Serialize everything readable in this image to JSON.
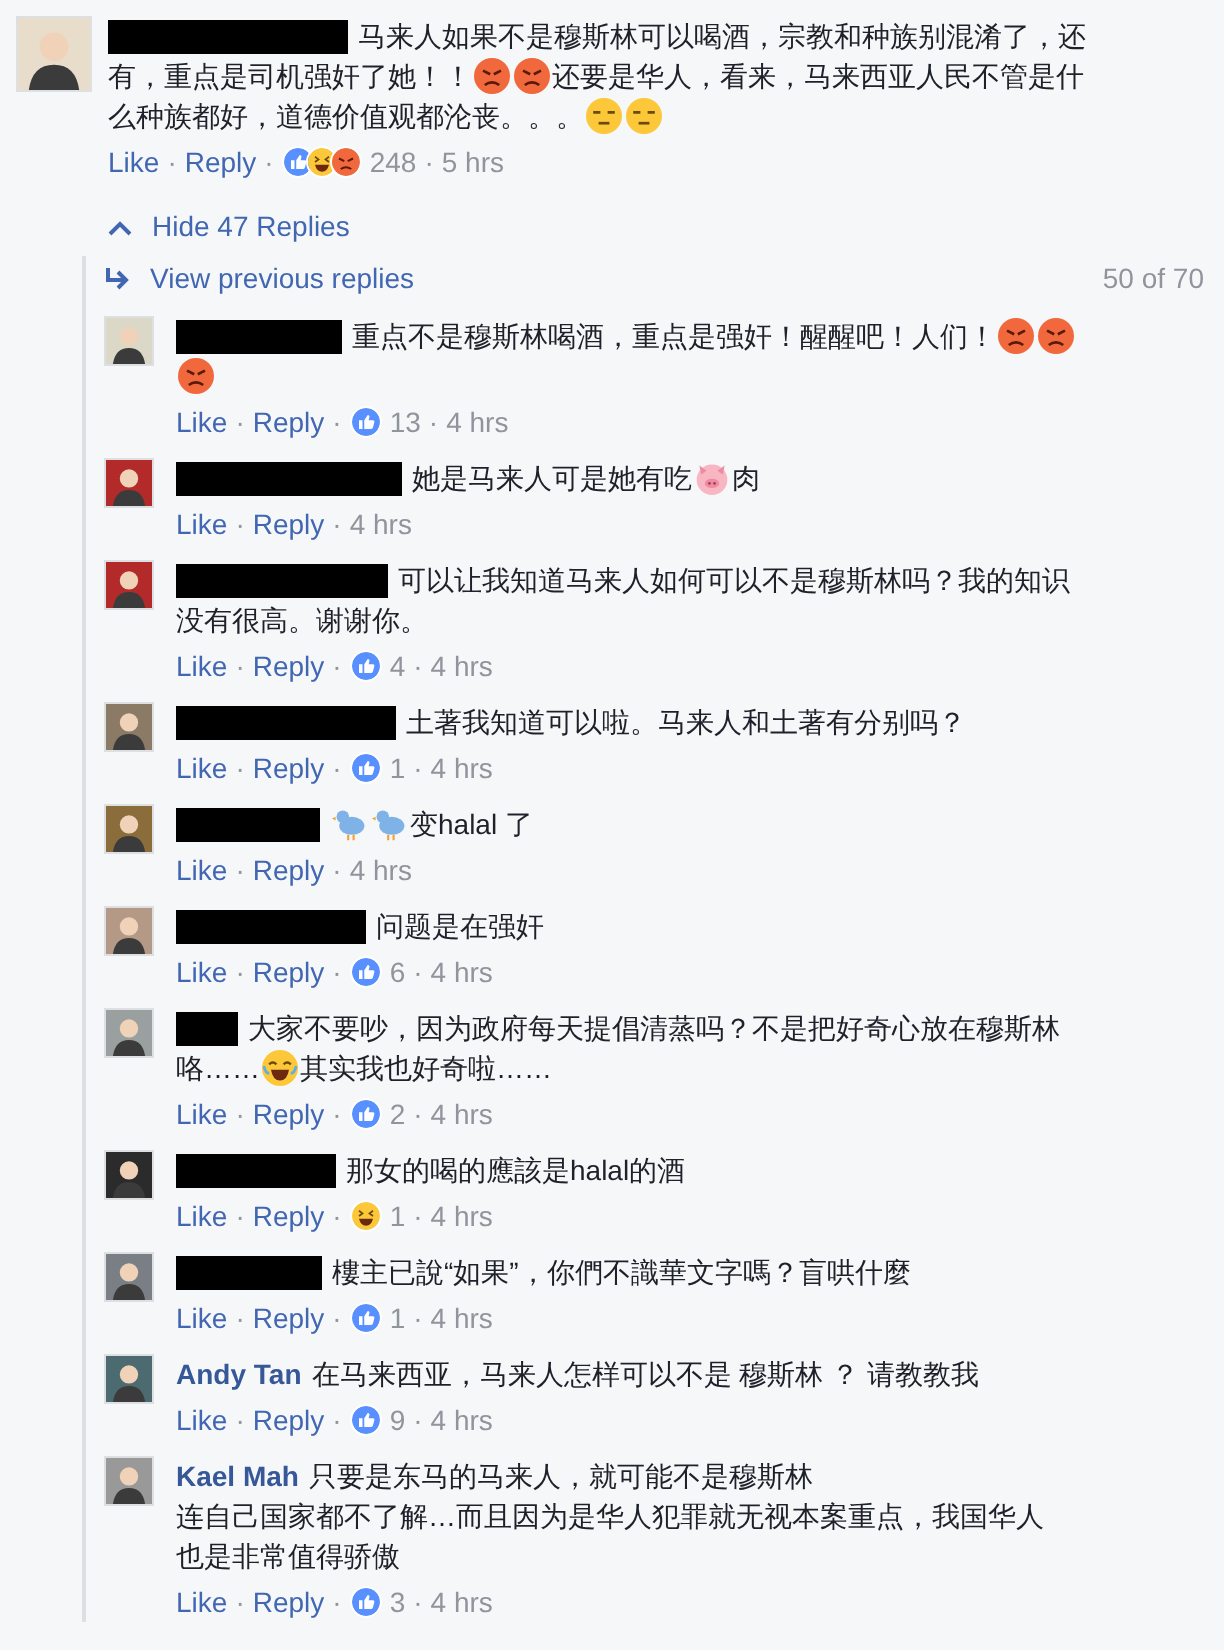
{
  "comment": {
    "author": {
      "kind": "redacted"
    },
    "lines": [
      [
        {
          "kind": "text",
          "text": "马来人如果不是穆斯林可以喝酒，宗教和种族别混淆了，还"
        }
      ],
      [
        {
          "kind": "text",
          "text": "有，重点是司机强奸了她！！"
        },
        {
          "kind": "angry"
        },
        {
          "kind": "angry"
        },
        {
          "kind": "text",
          "text": "还要是华人，看来，马来西亚人民不管是什"
        }
      ],
      [
        {
          "kind": "text",
          "text": "么种族都好，道德价值观都沦丧。。。"
        },
        {
          "kind": "unamused"
        },
        {
          "kind": "unamused"
        }
      ]
    ],
    "meta": [
      {
        "kind": "link",
        "text": "Like"
      },
      {
        "kind": "sep",
        "text": "·"
      },
      {
        "kind": "link",
        "text": "Reply"
      },
      {
        "kind": "sep",
        "text": "·"
      },
      {
        "kind": "reactions",
        "reactions": [
          {
            "kind": "like"
          },
          {
            "kind": "haha"
          },
          {
            "kind": "angry"
          }
        ]
      },
      {
        "kind": "count",
        "text": "248"
      },
      {
        "kind": "sep",
        "text": "·"
      },
      {
        "kind": "time",
        "text": "5 hrs"
      }
    ]
  },
  "replies_toggle": {
    "label": "Hide 47 Replies",
    "expanded": true
  },
  "previous": {
    "label": "View previous replies",
    "count": "50 of 70"
  },
  "replies": [
    {
      "author": {
        "kind": "redacted"
      },
      "lines": [
        [
          {
            "kind": "text",
            "text": "重点不是穆斯林喝酒，重点是强奸！醒醒吧！人们！"
          },
          {
            "kind": "angry"
          },
          {
            "kind": "angry"
          }
        ],
        [
          {
            "kind": "angry"
          }
        ]
      ],
      "meta": [
        {
          "kind": "link",
          "text": "Like"
        },
        {
          "kind": "sep",
          "text": "·"
        },
        {
          "kind": "link",
          "text": "Reply"
        },
        {
          "kind": "sep",
          "text": "·"
        },
        {
          "kind": "reactions",
          "reactions": [
            {
              "kind": "like"
            }
          ]
        },
        {
          "kind": "count",
          "text": "13"
        },
        {
          "kind": "sep",
          "text": "·"
        },
        {
          "kind": "time",
          "text": "4 hrs"
        }
      ]
    },
    {
      "author": {
        "kind": "redacted"
      },
      "lines": [
        [
          {
            "kind": "text",
            "text": "她是马来人可是她有吃"
          },
          {
            "kind": "pig"
          },
          {
            "kind": "text",
            "text": "肉"
          }
        ]
      ],
      "meta": [
        {
          "kind": "link",
          "text": "Like"
        },
        {
          "kind": "sep",
          "text": "·"
        },
        {
          "kind": "link",
          "text": "Reply"
        },
        {
          "kind": "sep",
          "text": "·"
        },
        {
          "kind": "time",
          "text": "4 hrs"
        }
      ]
    },
    {
      "author": {
        "kind": "redacted"
      },
      "lines": [
        [
          {
            "kind": "text",
            "text": "可以让我知道马来人如何可以不是穆斯林吗？我的知识"
          }
        ],
        [
          {
            "kind": "text",
            "text": "没有很高。谢谢你。"
          }
        ]
      ],
      "meta": [
        {
          "kind": "link",
          "text": "Like"
        },
        {
          "kind": "sep",
          "text": "·"
        },
        {
          "kind": "link",
          "text": "Reply"
        },
        {
          "kind": "sep",
          "text": "·"
        },
        {
          "kind": "reactions",
          "reactions": [
            {
              "kind": "like"
            }
          ]
        },
        {
          "kind": "count",
          "text": "4"
        },
        {
          "kind": "sep",
          "text": "·"
        },
        {
          "kind": "time",
          "text": "4 hrs"
        }
      ]
    },
    {
      "author": {
        "kind": "redacted"
      },
      "lines": [
        [
          {
            "kind": "text",
            "text": "土著我知道可以啦。马来人和土著有分别吗？"
          }
        ]
      ],
      "meta": [
        {
          "kind": "link",
          "text": "Like"
        },
        {
          "kind": "sep",
          "text": "·"
        },
        {
          "kind": "link",
          "text": "Reply"
        },
        {
          "kind": "sep",
          "text": "·"
        },
        {
          "kind": "reactions",
          "reactions": [
            {
              "kind": "like"
            }
          ]
        },
        {
          "kind": "count",
          "text": "1"
        },
        {
          "kind": "sep",
          "text": "·"
        },
        {
          "kind": "time",
          "text": "4 hrs"
        }
      ]
    },
    {
      "author": {
        "kind": "redacted"
      },
      "lines": [
        [
          {
            "kind": "bird"
          },
          {
            "kind": "bird"
          },
          {
            "kind": "text",
            "text": "变halal 了"
          }
        ]
      ],
      "meta": [
        {
          "kind": "link",
          "text": "Like"
        },
        {
          "kind": "sep",
          "text": "·"
        },
        {
          "kind": "link",
          "text": "Reply"
        },
        {
          "kind": "sep",
          "text": "·"
        },
        {
          "kind": "time",
          "text": "4 hrs"
        }
      ]
    },
    {
      "author": {
        "kind": "redacted"
      },
      "lines": [
        [
          {
            "kind": "text",
            "text": "问题是在强奸"
          }
        ]
      ],
      "meta": [
        {
          "kind": "link",
          "text": "Like"
        },
        {
          "kind": "sep",
          "text": "·"
        },
        {
          "kind": "link",
          "text": "Reply"
        },
        {
          "kind": "sep",
          "text": "·"
        },
        {
          "kind": "reactions",
          "reactions": [
            {
              "kind": "like"
            }
          ]
        },
        {
          "kind": "count",
          "text": "6"
        },
        {
          "kind": "sep",
          "text": "·"
        },
        {
          "kind": "time",
          "text": "4 hrs"
        }
      ]
    },
    {
      "author": {
        "kind": "redacted"
      },
      "lines": [
        [
          {
            "kind": "text",
            "text": "大家不要吵，因为政府每天提倡清蒸吗？不是把好奇心放在穆斯林"
          }
        ],
        [
          {
            "kind": "text",
            "text": "咯……"
          },
          {
            "kind": "laugh"
          },
          {
            "kind": "text",
            "text": "其实我也好奇啦……"
          }
        ]
      ],
      "meta": [
        {
          "kind": "link",
          "text": "Like"
        },
        {
          "kind": "sep",
          "text": "·"
        },
        {
          "kind": "link",
          "text": "Reply"
        },
        {
          "kind": "sep",
          "text": "·"
        },
        {
          "kind": "reactions",
          "reactions": [
            {
              "kind": "like"
            }
          ]
        },
        {
          "kind": "count",
          "text": "2"
        },
        {
          "kind": "sep",
          "text": "·"
        },
        {
          "kind": "time",
          "text": "4 hrs"
        }
      ]
    },
    {
      "author": {
        "kind": "redacted"
      },
      "lines": [
        [
          {
            "kind": "text",
            "text": "那女的喝的應該是halal的酒"
          }
        ]
      ],
      "meta": [
        {
          "kind": "link",
          "text": "Like"
        },
        {
          "kind": "sep",
          "text": "·"
        },
        {
          "kind": "link",
          "text": "Reply"
        },
        {
          "kind": "sep",
          "text": "·"
        },
        {
          "kind": "reactions",
          "reactions": [
            {
              "kind": "haha"
            }
          ]
        },
        {
          "kind": "count",
          "text": "1"
        },
        {
          "kind": "sep",
          "text": "·"
        },
        {
          "kind": "time",
          "text": "4 hrs"
        }
      ]
    },
    {
      "author": {
        "kind": "redacted"
      },
      "lines": [
        [
          {
            "kind": "text",
            "text": "樓主已說“如果”，你們不識華文字嗎？盲哄什麼"
          }
        ]
      ],
      "meta": [
        {
          "kind": "link",
          "text": "Like"
        },
        {
          "kind": "sep",
          "text": "·"
        },
        {
          "kind": "link",
          "text": "Reply"
        },
        {
          "kind": "sep",
          "text": "·"
        },
        {
          "kind": "reactions",
          "reactions": [
            {
              "kind": "like"
            }
          ]
        },
        {
          "kind": "count",
          "text": "1"
        },
        {
          "kind": "sep",
          "text": "·"
        },
        {
          "kind": "time",
          "text": "4 hrs"
        }
      ]
    },
    {
      "author": {
        "kind": "name",
        "name": "Andy Tan"
      },
      "lines": [
        [
          {
            "kind": "text",
            "text": "在马来西亚，马来人怎样可以不是 穆斯林 ？ 请教教我"
          }
        ]
      ],
      "meta": [
        {
          "kind": "link",
          "text": "Like"
        },
        {
          "kind": "sep",
          "text": "·"
        },
        {
          "kind": "link",
          "text": "Reply"
        },
        {
          "kind": "sep",
          "text": "·"
        },
        {
          "kind": "reactions",
          "reactions": [
            {
              "kind": "like"
            }
          ]
        },
        {
          "kind": "count",
          "text": "9"
        },
        {
          "kind": "sep",
          "text": "·"
        },
        {
          "kind": "time",
          "text": "4 hrs"
        }
      ]
    },
    {
      "author": {
        "kind": "name",
        "name": "Kael Mah"
      },
      "lines": [
        [
          {
            "kind": "text",
            "text": "只要是东马的马来人，就可能不是穆斯林"
          }
        ],
        [
          {
            "kind": "text",
            "text": "连自己国家都不了解…而且因为是华人犯罪就无视本案重点，我国华人"
          }
        ],
        [
          {
            "kind": "text",
            "text": "也是非常值得骄傲"
          }
        ]
      ],
      "meta": [
        {
          "kind": "link",
          "text": "Like"
        },
        {
          "kind": "sep",
          "text": "·"
        },
        {
          "kind": "link",
          "text": "Reply"
        },
        {
          "kind": "sep",
          "text": "·"
        },
        {
          "kind": "reactions",
          "reactions": [
            {
              "kind": "like"
            }
          ]
        },
        {
          "kind": "count",
          "text": "3"
        },
        {
          "kind": "sep",
          "text": "·"
        },
        {
          "kind": "time",
          "text": "4 hrs"
        }
      ]
    }
  ]
}
